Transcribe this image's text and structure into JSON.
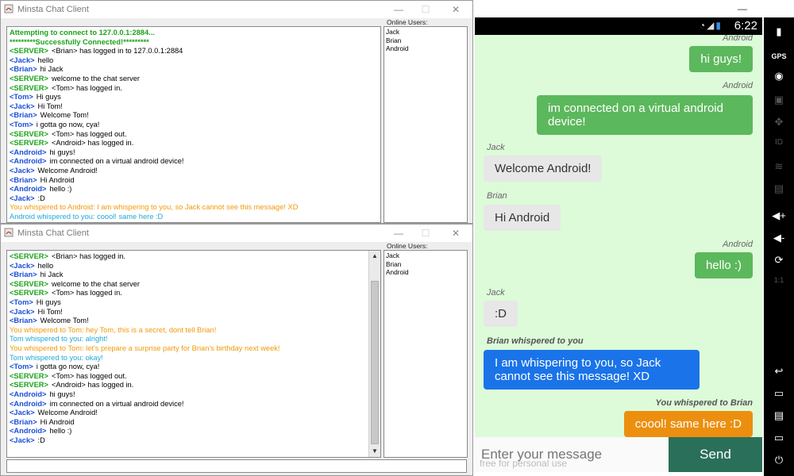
{
  "desktop": {
    "window1": {
      "title": "Minsta Chat Client",
      "online_label": "Online Users:",
      "online_users": [
        "Jack",
        "Brian",
        "Android"
      ],
      "lines": [
        {
          "cls": "sys",
          "who": "",
          "text": "Attempting to connect to 127.0.0.1:2884..."
        },
        {
          "cls": "sys",
          "who": "",
          "text": "*********Successfully Connected!*********"
        },
        {
          "cls": "g",
          "who": "<SERVER>",
          "text": "<Brian> has logged in to 127.0.0.1:2884"
        },
        {
          "cls": "b",
          "who": "<Jack>",
          "text": "hello"
        },
        {
          "cls": "b",
          "who": "<Brian>",
          "text": "hi Jack"
        },
        {
          "cls": "g",
          "who": "<SERVER>",
          "text": "welcome to the chat server"
        },
        {
          "cls": "g",
          "who": "<SERVER>",
          "text": "<Tom> has logged in."
        },
        {
          "cls": "b",
          "who": "<Tom>",
          "text": "Hi guys"
        },
        {
          "cls": "b",
          "who": "<Jack>",
          "text": "Hi Tom!"
        },
        {
          "cls": "b",
          "who": "<Brian>",
          "text": "Welcome Tom!"
        },
        {
          "cls": "b",
          "who": "<Tom>",
          "text": "i gotta go now, cya!"
        },
        {
          "cls": "g",
          "who": "<SERVER>",
          "text": "<Tom> has logged out."
        },
        {
          "cls": "g",
          "who": "<SERVER>",
          "text": "<Android> has logged in."
        },
        {
          "cls": "b",
          "who": "<Android>",
          "text": "hi guys!"
        },
        {
          "cls": "b",
          "who": "<Android>",
          "text": "im connected on a virtual android device!"
        },
        {
          "cls": "b",
          "who": "<Jack>",
          "text": "Welcome Android!"
        },
        {
          "cls": "b",
          "who": "<Brian>",
          "text": "Hi Android"
        },
        {
          "cls": "b",
          "who": "<Android>",
          "text": "hello :)"
        },
        {
          "cls": "b",
          "who": "<Jack>",
          "text": ":D"
        },
        {
          "cls": "o",
          "who": "",
          "text": "You whispered to Android: I am whispering to you, so Jack cannot see this message! XD"
        },
        {
          "cls": "c",
          "who": "",
          "text": "Android whispered to you: coool! same here :D"
        }
      ]
    },
    "window2": {
      "title": "Minsta Chat Client",
      "online_label": "Online Users:",
      "online_users": [
        "Jack",
        "Brian",
        "Android"
      ],
      "lines": [
        {
          "cls": "g",
          "who": "<SERVER>",
          "text": "<Brian> has logged in."
        },
        {
          "cls": "b",
          "who": "<Jack>",
          "text": "hello"
        },
        {
          "cls": "b",
          "who": "<Brian>",
          "text": "hi Jack"
        },
        {
          "cls": "g",
          "who": "<SERVER>",
          "text": "welcome to the chat server"
        },
        {
          "cls": "g",
          "who": "<SERVER>",
          "text": "<Tom> has logged in."
        },
        {
          "cls": "b",
          "who": "<Tom>",
          "text": "Hi guys"
        },
        {
          "cls": "b",
          "who": "<Jack>",
          "text": "Hi Tom!"
        },
        {
          "cls": "b",
          "who": "<Brian>",
          "text": "Welcome Tom!"
        },
        {
          "cls": "o",
          "who": "",
          "text": "You whispered to Tom: hey Tom, this is a secret, dont tell Brian!"
        },
        {
          "cls": "c",
          "who": "",
          "text": "Tom whispered to you:  alright!"
        },
        {
          "cls": "o",
          "who": "",
          "text": "You whispered to Tom:  let's prepare a surprise party for Brian's birthday next week!"
        },
        {
          "cls": "c",
          "who": "",
          "text": "Tom whispered to you:  okay!"
        },
        {
          "cls": "b",
          "who": "<Tom>",
          "text": "i gotta go now, cya!"
        },
        {
          "cls": "g",
          "who": "<SERVER>",
          "text": "<Tom> has logged out."
        },
        {
          "cls": "g",
          "who": "<SERVER>",
          "text": "<Android> has logged in."
        },
        {
          "cls": "b",
          "who": "<Android>",
          "text": "hi guys!"
        },
        {
          "cls": "b",
          "who": "<Android>",
          "text": "im connected on a virtual android device!"
        },
        {
          "cls": "b",
          "who": "<Jack>",
          "text": "Welcome Android!"
        },
        {
          "cls": "b",
          "who": "<Brian>",
          "text": "Hi Android"
        },
        {
          "cls": "b",
          "who": "<Android>",
          "text": "hello :)"
        },
        {
          "cls": "b",
          "who": "<Jack>",
          "text": ":D"
        }
      ]
    }
  },
  "android": {
    "clock": "6:22",
    "messages": [
      {
        "meta": "Android",
        "text": "hi guys!"
      },
      {
        "meta": "Android",
        "text": "im connected on a virtual android device!"
      },
      {
        "meta": "Jack",
        "text": "Welcome Android!"
      },
      {
        "meta": "Brian",
        "text": "Hi Android"
      },
      {
        "meta": "Android",
        "text": "hello :)"
      },
      {
        "meta": "Jack",
        "text": ":D"
      },
      {
        "meta": "Brian whispered to you",
        "text": "I am whispering to you, so Jack cannot see this message! XD"
      },
      {
        "meta": "You whispered to Brian",
        "text": "coool! same here :D"
      }
    ],
    "input_placeholder": "Enter your message",
    "watermark": "free for personal use",
    "send_label": "Send"
  },
  "colors": {
    "server": "#1aa31a",
    "user": "#1a4fd6",
    "whisper_out": "#f09a0c",
    "whisper_in": "#21a9d6",
    "android_bg": "#ddfbd9",
    "send_button": "#2a6f59"
  }
}
